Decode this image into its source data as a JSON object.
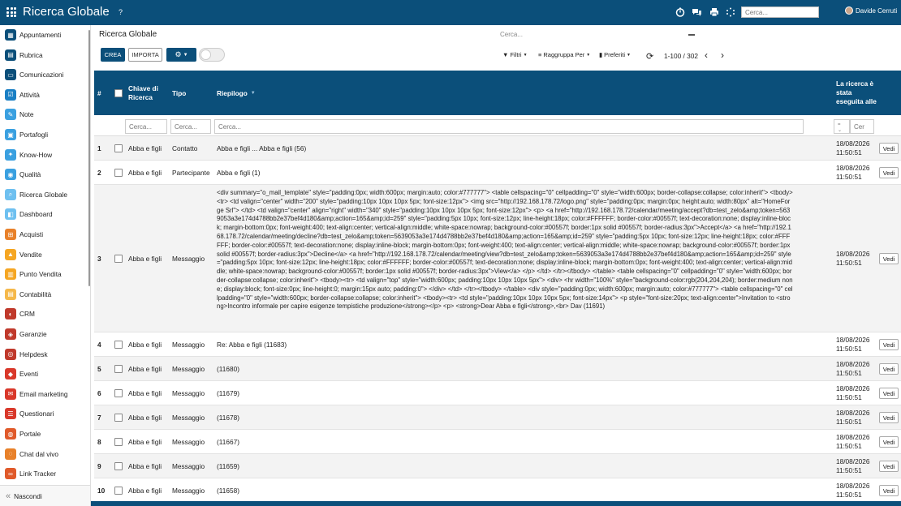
{
  "app": {
    "title": "Ricerca Globale",
    "help": "?",
    "search_placeholder": "Cerca...",
    "user_name": "Davide Cerruti"
  },
  "sidebar": {
    "items": [
      {
        "label": "Appuntamenti",
        "icon": "calendar-icon",
        "color": "#0b4f7a"
      },
      {
        "label": "Rubrica",
        "icon": "address-book-icon",
        "color": "#0b4f7a"
      },
      {
        "label": "Comunicazioni",
        "icon": "chat-bubble-icon",
        "color": "#0b4f7a"
      },
      {
        "label": "Attività",
        "icon": "checklist-icon",
        "color": "#1a7fc4"
      },
      {
        "label": "Note",
        "icon": "note-icon",
        "color": "#3aa0e0"
      },
      {
        "label": "Portafogli",
        "icon": "wallet-icon",
        "color": "#3aa0e0"
      },
      {
        "label": "Know-How",
        "icon": "lightbulb-icon",
        "color": "#3aa0e0"
      },
      {
        "label": "Qualità",
        "icon": "quality-gear-icon",
        "color": "#3aa0e0"
      },
      {
        "label": "Ricerca Globale",
        "icon": "search-icon",
        "color": "#6ec0f0"
      },
      {
        "label": "Dashboard",
        "icon": "dashboard-icon",
        "color": "#6ec0f0"
      },
      {
        "label": "Acquisti",
        "icon": "cart-icon",
        "color": "#e8812a"
      },
      {
        "label": "Vendite",
        "icon": "sales-icon",
        "color": "#f5a623"
      },
      {
        "label": "Punto Vendita",
        "icon": "store-icon",
        "color": "#f5a623"
      },
      {
        "label": "Contabilità",
        "icon": "accounting-icon",
        "color": "#f5b84a"
      },
      {
        "label": "CRM",
        "icon": "crm-icon",
        "color": "#c0392b"
      },
      {
        "label": "Garanzie",
        "icon": "shield-icon",
        "color": "#c0392b"
      },
      {
        "label": "Helpdesk",
        "icon": "headset-icon",
        "color": "#c0392b"
      },
      {
        "label": "Eventi",
        "icon": "event-icon",
        "color": "#d9382a"
      },
      {
        "label": "Email marketing",
        "icon": "email-icon",
        "color": "#d9382a"
      },
      {
        "label": "Questionari",
        "icon": "survey-icon",
        "color": "#d9382a"
      },
      {
        "label": "Portale",
        "icon": "portal-icon",
        "color": "#e05a2a"
      },
      {
        "label": "Chat dal vivo",
        "icon": "live-chat-icon",
        "color": "#e8812a"
      },
      {
        "label": "Link Tracker",
        "icon": "link-icon",
        "color": "#e05a2a"
      }
    ],
    "hide_label": "Nascondi"
  },
  "main": {
    "title": "Ricerca Globale",
    "search_placeholder": "Cerca...",
    "buttons": {
      "crea": "CREA",
      "importa": "IMPORTA"
    },
    "filters": {
      "filtri": "Filtri",
      "raggruppa": "Raggruppa Per",
      "preferiti": "Preferiti"
    },
    "pager": "1-100 / 302"
  },
  "table": {
    "headers": {
      "num": "#",
      "chiave": "Chiave di Ricerca",
      "tipo": "Tipo",
      "riepilogo": "Riepilogo",
      "data": "La ricerca è stata eseguita alle"
    },
    "filter_placeholders": {
      "chiave": "Cerca...",
      "tipo": "Cerca...",
      "riepilogo": "Cerca...",
      "data": "Cer"
    },
    "view_label": "Vedi",
    "rows": [
      {
        "n": "1",
        "key": "Abba e figli",
        "type": "Contatto",
        "summary": "Abba e figli ... Abba e figli (56)",
        "date": "18/08/2026",
        "time": "11:50:51"
      },
      {
        "n": "2",
        "key": "Abba e figli",
        "type": "Partecipante",
        "summary": "Abba e figli (1)",
        "date": "18/08/2026",
        "time": "11:50:51"
      },
      {
        "n": "3",
        "key": "Abba e figli",
        "type": "Messaggio",
        "summary": "<div summary=\"o_mail_template\" style=\"padding:0px; width:600px; margin:auto; color:#777777\"> <table cellspacing=\"0\" cellpadding=\"0\" style=\"width:600px; border-collapse:collapse; color:inherit\"> <tbody><tr> <td valign=\"center\" width=\"200\" style=\"padding:10px 10px 10px 5px; font-size:12px\"> <img src=\"http://192.168.178.72/logo.png\" style=\"padding:0px; margin:0px; height:auto; width:80px\" alt=\"HomeForge Srl\"> </td> <td valign=\"center\" align=\"right\" width=\"340\" style=\"padding:10px 10px 10px 5px; font-size:12px\"> <p> <a href=\"http://192.168.178.72/calendar/meeting/accept?db=test_zelo&amp;token=5639053a3e174d4788bb2e37bef4d180&amp;action=165&amp;id=259\" style=\"padding:5px 10px; font-size:12px; line-height:18px; color:#FFFFFF; border-color:#00557f; text-decoration:none; display:inline-block; margin-bottom:0px; font-weight:400; text-align:center; vertical-align:middle; white-space:nowrap; background-color:#00557f; border:1px solid #00557f; border-radius:3px\">Accept</a> <a href=\"http://192.168.178.72/calendar/meeting/decline?db=test_zelo&amp;token=5639053a3e174d4788bb2e37bef4d180&amp;action=165&amp;id=259\" style=\"padding:5px 10px; font-size:12px; line-height:18px; color:#FFFFFF; border-color:#00557f; text-decoration:none; display:inline-block; margin-bottom:0px; font-weight:400; text-align:center; vertical-align:middle; white-space:nowrap; background-color:#00557f; border:1px solid #00557f; border-radius:3px\">Decline</a> <a href=\"http://192.168.178.72/calendar/meeting/view?db=test_zelo&amp;token=5639053a3e174d4788bb2e37bef4d180&amp;action=165&amp;id=259\" style=\"padding:5px 10px; font-size:12px; line-height:18px; color:#FFFFFF; border-color:#00557f; text-decoration:none; display:inline-block; margin-bottom:0px; font-weight:400; text-align:center; vertical-align:middle; white-space:nowrap; background-color:#00557f; border:1px solid #00557f; border-radius:3px\">View</a> </p> </td> </tr></tbody> </table> <table cellspacing=\"0\" cellpadding=\"0\" style=\"width:600px; border-collapse:collapse; color:inherit\"> <tbody><tr> <td valign=\"top\" style=\"width:600px; padding:10px 10px 10px 5px\"> <div> <hr width=\"100%\" style=\"background-color:rgb(204,204,204); border:medium none; display:block; font-size:0px; line-height:0; margin:15px auto; padding:0\"> </div> </td> </tr></tbody> </table> <div style=\"padding:0px; width:600px; margin:auto; color:#777777\"> <table cellspacing=\"0\" cellpadding=\"0\" style=\"width:600px; border-collapse:collapse; color:inherit\"> <tbody><tr> <td style=\"padding:10px 10px 10px 5px; font-size:14px\"> <p style=\"font-size:20px; text-align:center\">Invitation to <strong>Incontro informale per capire esigenze tempistiche produzione</strong></p> <p> <strong>Dear Abba e figli</strong>,<br> Dav (11691)",
        "date": "18/08/2026",
        "time": "11:50:51"
      },
      {
        "n": "4",
        "key": "Abba e figli",
        "type": "Messaggio",
        "summary": "Re: Abba e figli (11683)",
        "date": "18/08/2026",
        "time": "11:50:51"
      },
      {
        "n": "5",
        "key": "Abba e figli",
        "type": "Messaggio",
        "summary": "(11680)",
        "date": "18/08/2026",
        "time": "11:50:51"
      },
      {
        "n": "6",
        "key": "Abba e figli",
        "type": "Messaggio",
        "summary": "(11679)",
        "date": "18/08/2026",
        "time": "11:50:51"
      },
      {
        "n": "7",
        "key": "Abba e figli",
        "type": "Messaggio",
        "summary": "(11678)",
        "date": "18/08/2026",
        "time": "11:50:51"
      },
      {
        "n": "8",
        "key": "Abba e figli",
        "type": "Messaggio",
        "summary": "(11667)",
        "date": "18/08/2026",
        "time": "11:50:51"
      },
      {
        "n": "9",
        "key": "Abba e figli",
        "type": "Messaggio",
        "summary": "(11659)",
        "date": "18/08/2026",
        "time": "11:50:51"
      },
      {
        "n": "10",
        "key": "Abba e figli",
        "type": "Messaggio",
        "summary": "(11658)",
        "date": "18/08/2026",
        "time": "11:50:51"
      }
    ]
  }
}
